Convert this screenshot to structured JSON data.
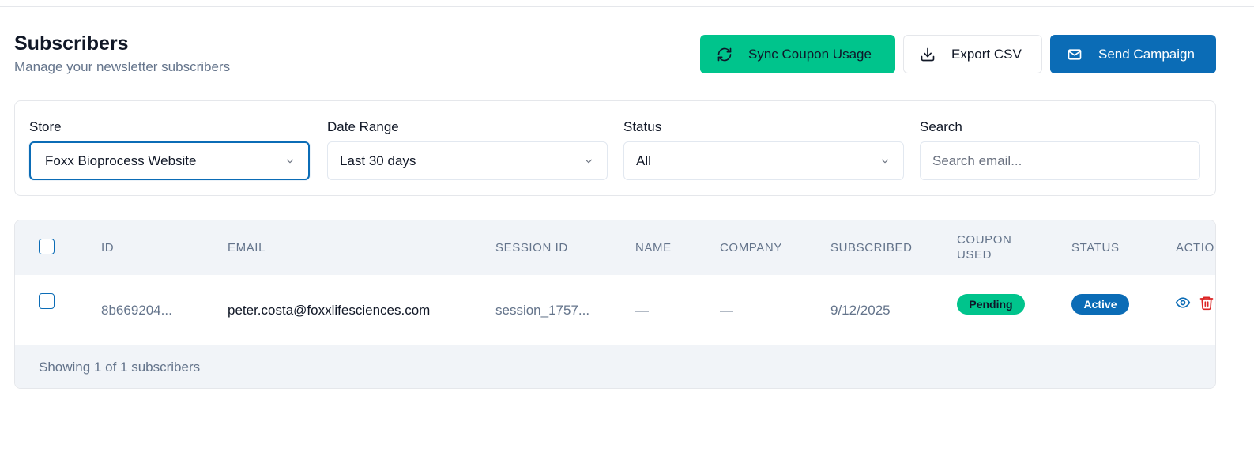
{
  "page": {
    "title": "Subscribers",
    "subtitle": "Manage your newsletter subscribers"
  },
  "actions": {
    "sync_label": "Sync Coupon Usage",
    "export_label": "Export CSV",
    "send_label": "Send Campaign"
  },
  "filters": {
    "store": {
      "label": "Store",
      "value": "Foxx Bioprocess Website"
    },
    "date_range": {
      "label": "Date Range",
      "value": "Last 30 days"
    },
    "status": {
      "label": "Status",
      "value": "All"
    },
    "search": {
      "label": "Search",
      "placeholder": "Search email..."
    }
  },
  "table": {
    "columns": {
      "id": "ID",
      "email": "EMAIL",
      "session_id": "SESSION ID",
      "name": "NAME",
      "company": "COMPANY",
      "subscribed": "SUBSCRIBED",
      "coupon_used_1": "COUPON",
      "coupon_used_2": "USED",
      "status": "STATUS",
      "actions": "ACTIONS"
    },
    "rows": [
      {
        "id": "8b669204...",
        "email": "peter.costa@foxxlifesciences.com",
        "session_id": "session_1757...",
        "name": "—",
        "company": "—",
        "subscribed": "9/12/2025",
        "coupon_used": "Pending",
        "status": "Active"
      }
    ],
    "footer": "Showing 1 of 1 subscribers"
  },
  "colors": {
    "primary": "#0b6cb6",
    "success": "#00c48c",
    "danger": "#dc2626",
    "muted": "#64748b"
  },
  "icons": {
    "sync": "refresh-icon",
    "export": "download-icon",
    "send": "mail-icon",
    "view": "eye-icon",
    "delete": "trash-icon"
  }
}
